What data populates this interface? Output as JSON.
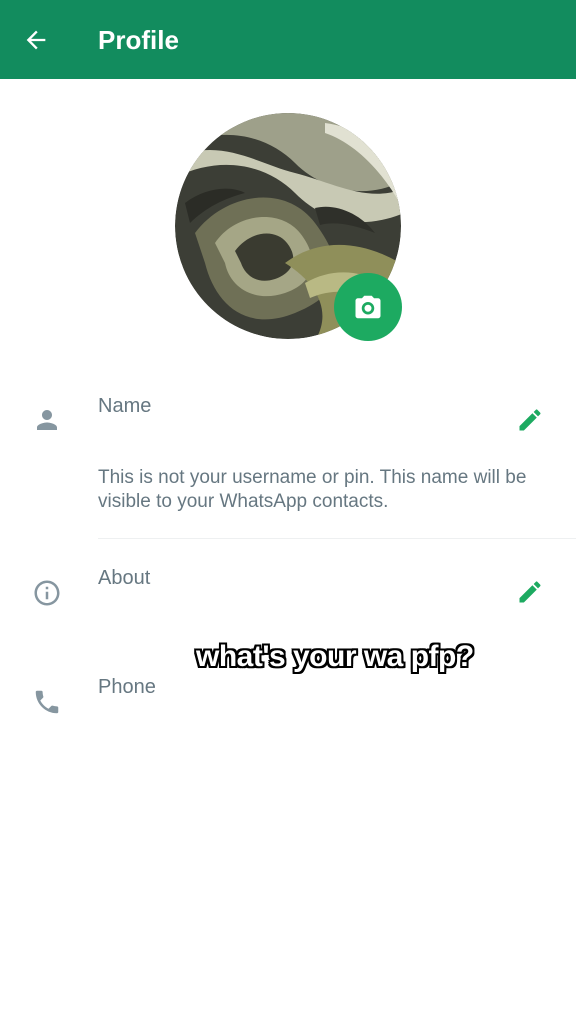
{
  "header": {
    "title": "Profile",
    "back_icon": "arrow-left-icon"
  },
  "profile_photo": {
    "description_icon": "avatar-image",
    "camera_icon": "camera-icon"
  },
  "fields": {
    "name": {
      "label": "Name",
      "value": "",
      "icon": "person-icon",
      "edit_icon": "pencil-icon",
      "hint": "This is not your username or pin. This name will be visible to your WhatsApp contacts."
    },
    "about": {
      "label": "About",
      "value": "",
      "icon": "info-icon",
      "edit_icon": "pencil-icon"
    },
    "phone": {
      "label": "Phone",
      "value": "",
      "icon": "phone-icon"
    }
  },
  "overlay": {
    "caption": "what's your wa pfp?"
  },
  "colors": {
    "header": "#128c5e",
    "accent": "#1daa61",
    "icon_gray": "#8696a0",
    "label_gray": "#667781"
  }
}
